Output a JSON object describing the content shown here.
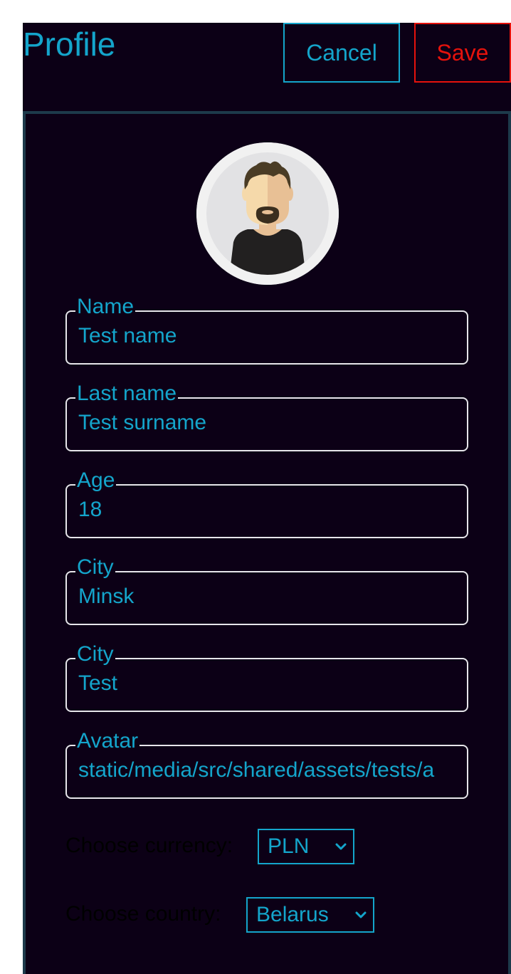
{
  "header": {
    "title": "Profile",
    "cancel_label": "Cancel",
    "save_label": "Save"
  },
  "profile": {
    "avatar_icon": "user-avatar-icon",
    "fields": [
      {
        "label": "Name",
        "value": "Test name"
      },
      {
        "label": "Last name",
        "value": "Test surname"
      },
      {
        "label": "Age",
        "value": "18"
      },
      {
        "label": "City",
        "value": "Minsk"
      },
      {
        "label": "City",
        "value": "Test"
      },
      {
        "label": "Avatar",
        "value": "static/media/src/shared/assets/tests/a"
      }
    ],
    "currency": {
      "label": "Choose currency:",
      "selected": "PLN"
    },
    "country": {
      "label": "Choose country:",
      "selected": "Belarus"
    }
  },
  "colors": {
    "background": "#0c0016",
    "accent": "#14a5cb",
    "danger": "#e5120c",
    "card_border": "#1d3a4b"
  }
}
